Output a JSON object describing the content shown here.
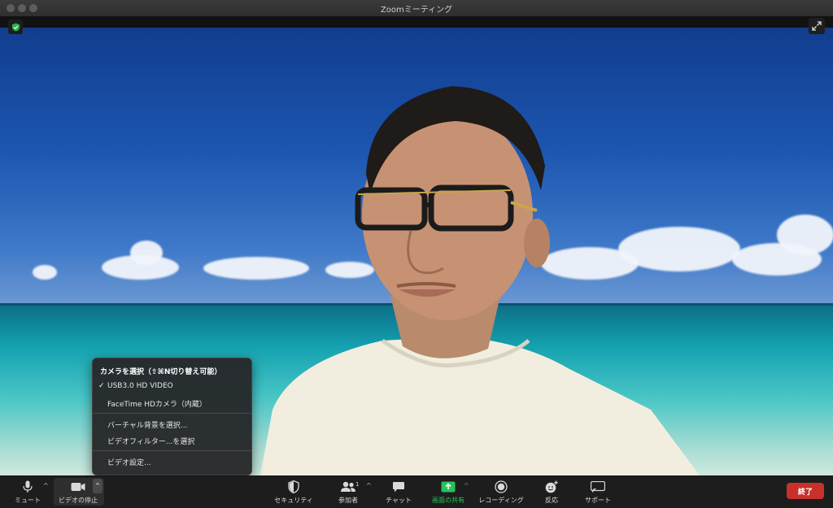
{
  "window": {
    "title": "Zoomミーティング"
  },
  "camera_menu": {
    "header": "カメラを選択（⇧⌘N切り替え可能）",
    "devices": [
      {
        "label": "USB3.0 HD VIDEO",
        "selected": true
      },
      {
        "label": "FaceTime HDカメラ（内蔵）",
        "selected": false
      }
    ],
    "actions": [
      {
        "label": "バーチャル背景を選択..."
      },
      {
        "label": "ビデオフィルター...を選択"
      }
    ],
    "settings_label": "ビデオ設定..."
  },
  "toolbar": {
    "mute_label": "ミュート",
    "video_label": "ビデオの停止",
    "security_label": "セキュリティ",
    "participants_label": "参加者",
    "participants_count": "1",
    "chat_label": "チャット",
    "share_label": "画面の共有",
    "record_label": "レコーディング",
    "reactions_label": "反応",
    "support_label": "サポート",
    "end_label": "終了"
  },
  "colors": {
    "end_button": "#c8312b",
    "share_accent": "#27c25a",
    "security_shield": "#2bb24c"
  },
  "icons": [
    "shield-icon",
    "expand-icon",
    "mic-icon",
    "video-camera-icon",
    "security-icon",
    "participants-icon",
    "chat-icon",
    "share-screen-icon",
    "record-icon",
    "reactions-icon",
    "support-icon",
    "chevron-up-icon",
    "check-icon"
  ]
}
